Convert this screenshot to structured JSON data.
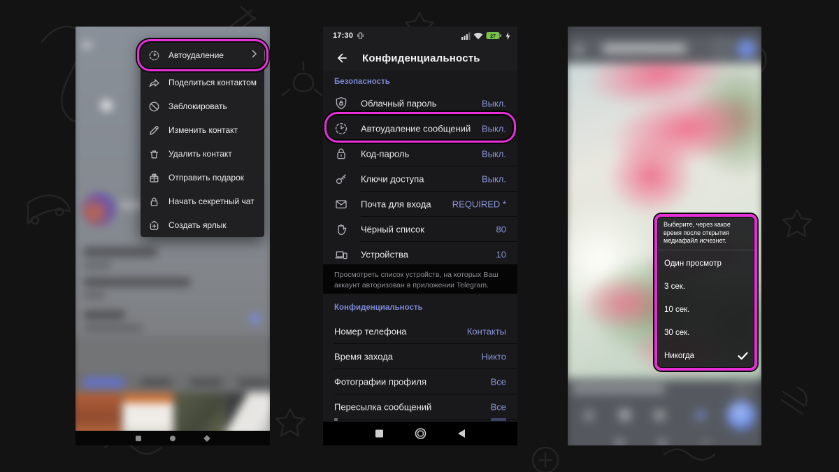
{
  "colors": {
    "highlight_magenta": "#e72fd8",
    "value_blue": "#8a95d8",
    "section_title_blue": "#7b87d2",
    "battery_green": "#79c14b"
  },
  "left_screen": {
    "context_menu": {
      "items": [
        {
          "label": "Автоудаление",
          "icon": "auto-delete-clock-icon",
          "highlighted": true
        },
        {
          "label": "Поделиться контактом",
          "icon": "share-arrow-icon"
        },
        {
          "label": "Заблокировать",
          "icon": "block-icon"
        },
        {
          "label": "Изменить контакт",
          "icon": "edit-pencil-icon"
        },
        {
          "label": "Удалить контакт",
          "icon": "trash-icon"
        },
        {
          "label": "Отправить подарок",
          "icon": "gift-icon"
        },
        {
          "label": "Начать секретный чат",
          "icon": "lock-icon"
        },
        {
          "label": "Создать ярлык",
          "icon": "add-shortcut-icon"
        }
      ]
    }
  },
  "middle_screen": {
    "status_bar": {
      "time": "17:30",
      "battery_percent": "27"
    },
    "header": {
      "title": "Конфиденциальность"
    },
    "security_section": {
      "title": "Безопасность",
      "rows": [
        {
          "label": "Облачный пароль",
          "value": "Выкл.",
          "icon": "shield-lock-icon"
        },
        {
          "label": "Автоудаление сообщений",
          "value": "Выкл.",
          "icon": "auto-delete-clock-icon",
          "highlighted": true
        },
        {
          "label": "Код-пароль",
          "value": "Выкл.",
          "icon": "lock-icon"
        },
        {
          "label": "Ключи доступа",
          "value": "Выкл.",
          "icon": "key-icon"
        },
        {
          "label": "Почта для входа",
          "value": "REQUIRED *",
          "icon": "envelope-icon"
        },
        {
          "label": "Чёрный список",
          "value": "80",
          "icon": "hand-icon"
        },
        {
          "label": "Устройства",
          "value": "10",
          "icon": "devices-icon"
        }
      ],
      "note": "Просмотреть список устройств, на которых Ваш аккаунт авторизован в приложении Telegram."
    },
    "privacy_section": {
      "title": "Конфиденциальность",
      "rows": [
        {
          "label": "Номер телефона",
          "value": "Контакты"
        },
        {
          "label": "Время захода",
          "value": "Никто"
        },
        {
          "label": "Фотографии профиля",
          "value": "Все"
        },
        {
          "label": "Пересылка сообщений",
          "value": "Все"
        }
      ]
    }
  },
  "right_screen": {
    "timer_popup": {
      "prompt": "Выберите, через какое время после открытия медиафайл исчезнет.",
      "options": [
        {
          "label": "Один просмотр",
          "selected": false
        },
        {
          "label": "3 сек.",
          "selected": false
        },
        {
          "label": "10 сек.",
          "selected": false
        },
        {
          "label": "30 сек.",
          "selected": false
        },
        {
          "label": "Никогда",
          "selected": true
        }
      ]
    }
  }
}
